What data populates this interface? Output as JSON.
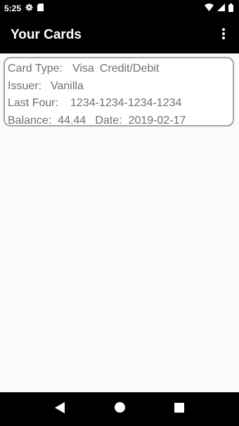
{
  "status_bar": {
    "time": "5:25",
    "icons": [
      "gear-icon",
      "sd-card-icon",
      "wifi-icon",
      "signal-icon",
      "battery-icon"
    ]
  },
  "app_bar": {
    "title": "Your Cards",
    "menu_icon": "overflow-menu-icon"
  },
  "cards": [
    {
      "card_type_label": "Card Type:",
      "card_type_value": "Visa",
      "card_kind": "Credit/Debit",
      "issuer_label": "Issuer:",
      "issuer_value": "Vanilla",
      "last_four_label": "Last Four:",
      "last_four_value": "1234-1234-1234-1234",
      "balance_label": "Balance:",
      "balance_value": "44.44",
      "date_label": "Date:",
      "date_value": "2019-02-17"
    }
  ],
  "nav_bar": {
    "buttons": [
      "back-icon",
      "home-icon",
      "recents-icon"
    ]
  },
  "colors": {
    "bars": "#000000",
    "background": "#fafafa",
    "card_border": "#9aa6a6",
    "card_text": "#707070"
  }
}
